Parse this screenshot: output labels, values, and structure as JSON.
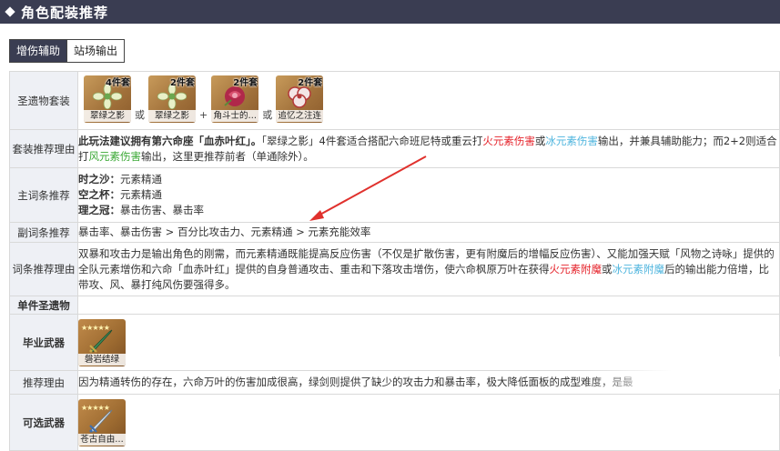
{
  "header": {
    "title": "角色配装推荐"
  },
  "tabs": [
    {
      "label": "增伤辅助"
    },
    {
      "label": "站场输出"
    }
  ],
  "artifact_row": {
    "label": "圣遗物套装",
    "cards": [
      {
        "count": "4件套",
        "name": "翠绿之影",
        "icon": "green-flower-icon"
      },
      {
        "count": "2件套",
        "name": "翠绿之影",
        "icon": "green-flower-icon"
      },
      {
        "count": "2件套",
        "name": "角斗士的…",
        "icon": "red-rose-icon"
      },
      {
        "count": "2件套",
        "name": "追忆之注连",
        "icon": "ribbon-flower-icon"
      }
    ],
    "separators": [
      "或",
      "+",
      "或"
    ]
  },
  "set_reason": {
    "label": "套装推荐理由",
    "bold": "此玩法建议拥有第六命座「血赤叶红」。",
    "t1": "「翠绿之影」4件套适合搭配六命班尼特或重云打",
    "fire": "火元素伤害",
    "or1": "或",
    "ice": "冰元素伤害",
    "t2": "输出，并兼具辅助能力；而2+2则适合打",
    "wind": "风元素伤害",
    "t3": "输出，这里更推荐前者（单通除外）。"
  },
  "main_stats": {
    "label": "主词条推荐",
    "items": [
      {
        "key": "时之沙：",
        "value": "元素精通"
      },
      {
        "key": "空之杯：",
        "value": "元素精通"
      },
      {
        "key": "理之冠：",
        "value": "暴击伤害、暴击率"
      }
    ]
  },
  "sub_stats": {
    "label": "副词条推荐",
    "text": "暴击率、暴击伤害 > 百分比攻击力、元素精通 > 元素充能效率"
  },
  "stat_reason": {
    "label": "词条推荐理由",
    "t1": "双暴和攻击力是输出角色的刚需，而元素精通既能提高反应伤害（不仅是扩散伤害，更有附魔后的增幅反应伤害）、又能加强天赋「风物之诗咏」提供的全队元素增伤和六命「血赤叶红」提供的自身普通攻击、重击和下落攻击增伤，使六命枫原万叶在获得",
    "fire": "火元素附魔",
    "or1": "或",
    "ice": "冰元素附魔",
    "t2": "后的输出能力倍增，比带攻、风、暴打纯风伤要强得多。"
  },
  "single_artifact": {
    "label": "单件圣遗物"
  },
  "best_weapon": {
    "label": "毕业武器",
    "stars": "★★★★★",
    "name": "磐岩结绿"
  },
  "weapon_reason": {
    "label": "推荐理由",
    "text": "因为精通转伤的存在，六命万叶的伤害加成很高，绿剑则提供了缺少的攻击力和暴击率，极大降低面板的成型难度，是最"
  },
  "alt_weapon": {
    "label": "可选武器",
    "stars": "★★★★★",
    "name": "苍古自由…"
  },
  "colors": {
    "header_bg": "#3a3d52",
    "fire": "#e5232b",
    "ice": "#4fb5de",
    "wind": "#3aa835",
    "annotation_arrow": "#e0312d"
  }
}
